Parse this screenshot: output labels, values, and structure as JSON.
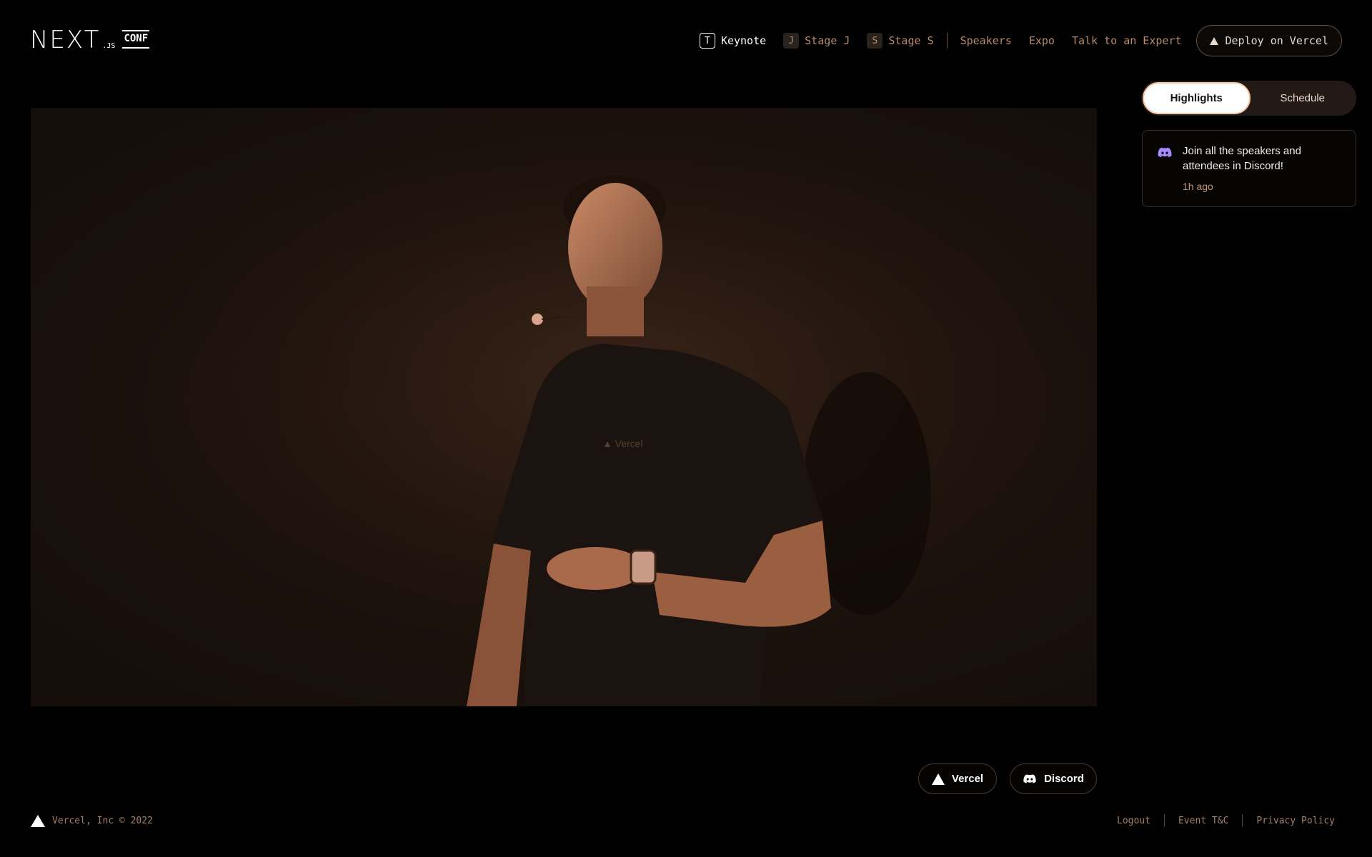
{
  "logo": {
    "main": "NEXT",
    "suffix": ".JS",
    "badge": "CONF"
  },
  "nav": {
    "items": [
      {
        "key": "T",
        "label": "Keynote",
        "active": true
      },
      {
        "key": "J",
        "label": "Stage J"
      },
      {
        "key": "S",
        "label": "Stage S"
      },
      {
        "label": "Speakers"
      },
      {
        "label": "Expo"
      },
      {
        "label": "Talk to an Expert"
      }
    ],
    "deploy_label": "Deploy on Vercel"
  },
  "sidebar": {
    "tabs": [
      "Highlights",
      "Schedule"
    ],
    "active_tab": "Highlights",
    "highlight": {
      "icon": "discord-icon",
      "text": "Join all the speakers and attendees in Discord!",
      "time": "1h ago"
    }
  },
  "bottom_buttons": {
    "vercel": "Vercel",
    "discord": "Discord"
  },
  "footer": {
    "copyright": "Vercel, Inc © 2022",
    "links": [
      "Logout",
      "Event T&C",
      "Privacy Policy"
    ]
  },
  "colors": {
    "accent": "#b88a6e",
    "discord": "#a88bff",
    "bg": "#000000"
  }
}
